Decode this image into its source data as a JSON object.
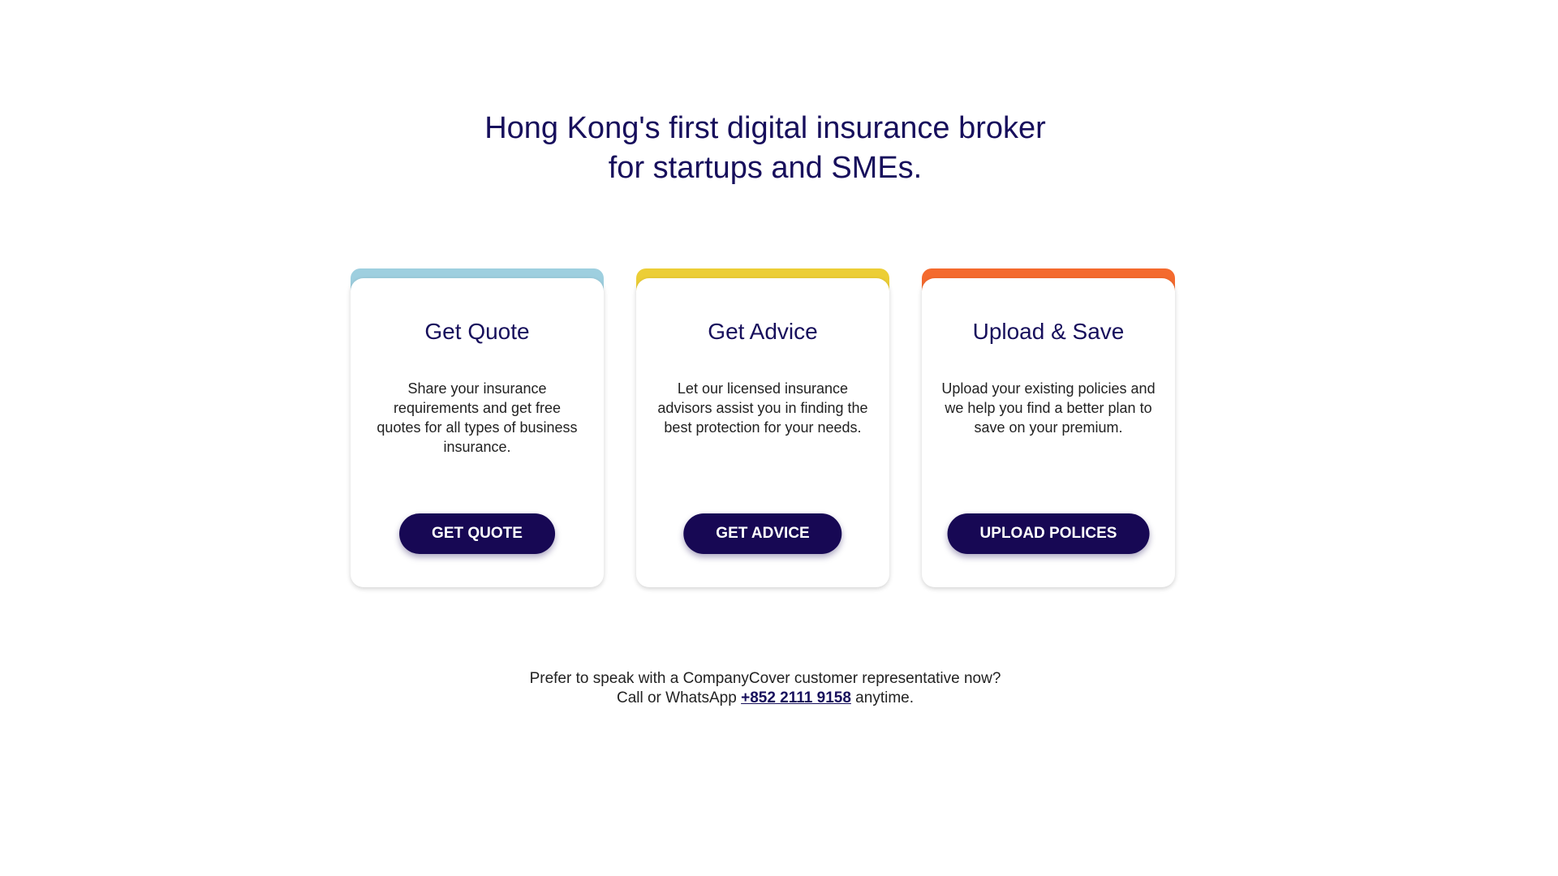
{
  "hero": {
    "title_line1": "Hong Kong's first digital insurance broker",
    "title_line2": "for startups and SMEs."
  },
  "cards": [
    {
      "title": "Get Quote",
      "description": "Share your insurance requirements and get free quotes for all types of business insurance.",
      "button": "GET QUOTE",
      "accent_color": "#9ecfdf"
    },
    {
      "title": "Get Advice",
      "description": "Let our licensed insurance advisors assist you in finding the best protection for your needs.",
      "button": "GET ADVICE",
      "accent_color": "#ecce36"
    },
    {
      "title": "Upload & Save",
      "description": "Upload your existing policies and we help you find a better plan to save on your premium.",
      "button": "UPLOAD POLICES",
      "accent_color": "#f46a2e"
    }
  ],
  "contact": {
    "line1": "Prefer to speak with a CompanyCover customer representative now?",
    "line2_prefix": "Call or WhatsApp ",
    "phone": "+852 2111 9158",
    "line2_suffix": " anytime."
  },
  "colors": {
    "brand_navy": "#170854",
    "heading": "#170f5c"
  }
}
